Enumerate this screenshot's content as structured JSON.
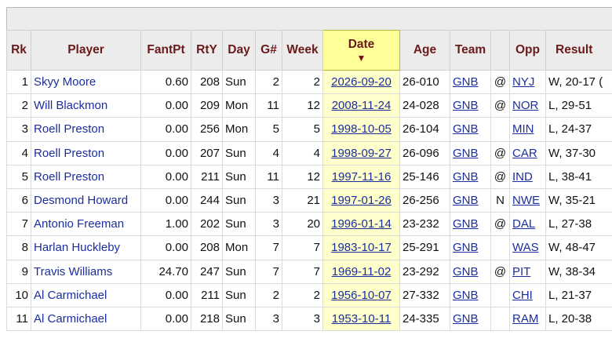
{
  "columns": {
    "rk": "Rk",
    "player": "Player",
    "fantpt": "FantPt",
    "rty": "RtY",
    "day": "Day",
    "gnum": "G#",
    "week": "Week",
    "date": "Date",
    "sort_arrow": "▼",
    "age": "Age",
    "team": "Team",
    "loc": "",
    "opp": "Opp",
    "result": "Result"
  },
  "rows": [
    {
      "rk": "1",
      "player": "Skyy Moore",
      "fantpt": "0.60",
      "rty": "208",
      "day": "Sun",
      "gnum": "2",
      "week": "2",
      "date": "2026-09-20",
      "age": "26-010",
      "team": "GNB",
      "loc": "@",
      "opp": "NYJ",
      "result": "W, 20-17 ("
    },
    {
      "rk": "2",
      "player": "Will Blackmon",
      "fantpt": "0.00",
      "rty": "209",
      "day": "Mon",
      "gnum": "11",
      "week": "12",
      "date": "2008-11-24",
      "age": "24-028",
      "team": "GNB",
      "loc": "@",
      "opp": "NOR",
      "result": "L, 29-51"
    },
    {
      "rk": "3",
      "player": "Roell Preston",
      "fantpt": "0.00",
      "rty": "256",
      "day": "Mon",
      "gnum": "5",
      "week": "5",
      "date": "1998-10-05",
      "age": "26-104",
      "team": "GNB",
      "loc": "",
      "opp": "MIN",
      "result": "L, 24-37"
    },
    {
      "rk": "4",
      "player": "Roell Preston",
      "fantpt": "0.00",
      "rty": "207",
      "day": "Sun",
      "gnum": "4",
      "week": "4",
      "date": "1998-09-27",
      "age": "26-096",
      "team": "GNB",
      "loc": "@",
      "opp": "CAR",
      "result": "W, 37-30"
    },
    {
      "rk": "5",
      "player": "Roell Preston",
      "fantpt": "0.00",
      "rty": "211",
      "day": "Sun",
      "gnum": "11",
      "week": "12",
      "date": "1997-11-16",
      "age": "25-146",
      "team": "GNB",
      "loc": "@",
      "opp": "IND",
      "result": "L, 38-41"
    },
    {
      "rk": "6",
      "player": "Desmond Howard",
      "fantpt": "0.00",
      "rty": "244",
      "day": "Sun",
      "gnum": "3",
      "week": "21",
      "date": "1997-01-26",
      "age": "26-256",
      "team": "GNB",
      "loc": "N",
      "opp": "NWE",
      "result": "W, 35-21"
    },
    {
      "rk": "7",
      "player": "Antonio Freeman",
      "fantpt": "1.00",
      "rty": "202",
      "day": "Sun",
      "gnum": "3",
      "week": "20",
      "date": "1996-01-14",
      "age": "23-232",
      "team": "GNB",
      "loc": "@",
      "opp": "DAL",
      "result": "L, 27-38"
    },
    {
      "rk": "8",
      "player": "Harlan Huckleby",
      "fantpt": "0.00",
      "rty": "208",
      "day": "Mon",
      "gnum": "7",
      "week": "7",
      "date": "1983-10-17",
      "age": "25-291",
      "team": "GNB",
      "loc": "",
      "opp": "WAS",
      "result": "W, 48-47"
    },
    {
      "rk": "9",
      "player": "Travis Williams",
      "fantpt": "24.70",
      "rty": "247",
      "day": "Sun",
      "gnum": "7",
      "week": "7",
      "date": "1969-11-02",
      "age": "23-292",
      "team": "GNB",
      "loc": "@",
      "opp": "PIT",
      "result": "W, 38-34"
    },
    {
      "rk": "10",
      "player": "Al Carmichael",
      "fantpt": "0.00",
      "rty": "211",
      "day": "Sun",
      "gnum": "2",
      "week": "2",
      "date": "1956-10-07",
      "age": "27-332",
      "team": "GNB",
      "loc": "",
      "opp": "CHI",
      "result": "L, 21-37"
    },
    {
      "rk": "11",
      "player": "Al Carmichael",
      "fantpt": "0.00",
      "rty": "218",
      "day": "Sun",
      "gnum": "3",
      "week": "3",
      "date": "1953-10-11",
      "age": "24-335",
      "team": "GNB",
      "loc": "",
      "opp": "RAM",
      "result": "L, 20-38"
    }
  ]
}
